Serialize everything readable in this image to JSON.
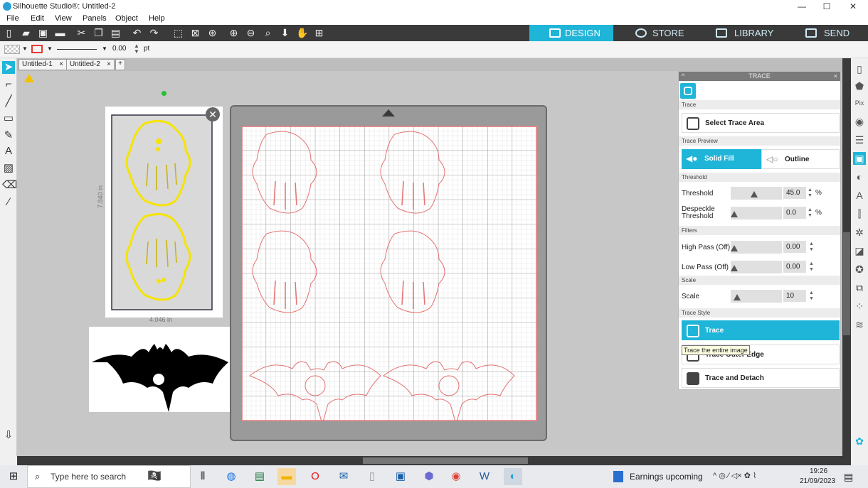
{
  "window": {
    "title": "Silhouette Studio®: Untitled-2",
    "min": "—",
    "max": "☐",
    "close": "✕"
  },
  "menu": [
    "File",
    "Edit",
    "View",
    "Panels",
    "Object",
    "Help"
  ],
  "nav_tabs": {
    "design": "DESIGN",
    "store": "STORE",
    "library": "LIBRARY",
    "send": "SEND"
  },
  "props": {
    "line_width": "0.00",
    "unit": "pt"
  },
  "doc_tabs": [
    "Untitled-1",
    "Untitled-2"
  ],
  "selection": {
    "height": "7.840 in",
    "width": "4.046 in"
  },
  "trace": {
    "panel_title": "TRACE",
    "sec_trace": "Trace",
    "select_area": "Select Trace Area",
    "sec_preview": "Trace Preview",
    "solid_fill": "Solid Fill",
    "outline": "Outline",
    "sec_threshold": "Threshold",
    "threshold_label": "Threshold",
    "threshold_value": "45.0",
    "threshold_level": 0.45,
    "despeckle_label": "Despeckle Threshold",
    "despeckle_value": "0.0",
    "despeckle_level": 0.0,
    "pct": "%",
    "sec_filters": "Filters",
    "high_pass_label": "High Pass (Off)",
    "high_pass_value": "0.00",
    "low_pass_label": "Low Pass (Off)",
    "low_pass_value": "0.00",
    "sec_scale": "Scale",
    "scale_label": "Scale",
    "scale_value": "10",
    "sec_style": "Trace Style",
    "btn_trace": "Trace",
    "btn_outer": "Trace Outer Edge",
    "btn_detach": "Trace and Detach",
    "tooltip": "Trace the entire image"
  },
  "taskbar": {
    "search_placeholder": "Type here to search",
    "news": "Earnings upcoming",
    "time": "19:26",
    "date": "21/09/2023"
  },
  "colors": {
    "accent": "#1fb5d8",
    "toolbar": "#3a3a3a",
    "trace_yellow": "#f5e400",
    "cut_red": "#e57373"
  }
}
